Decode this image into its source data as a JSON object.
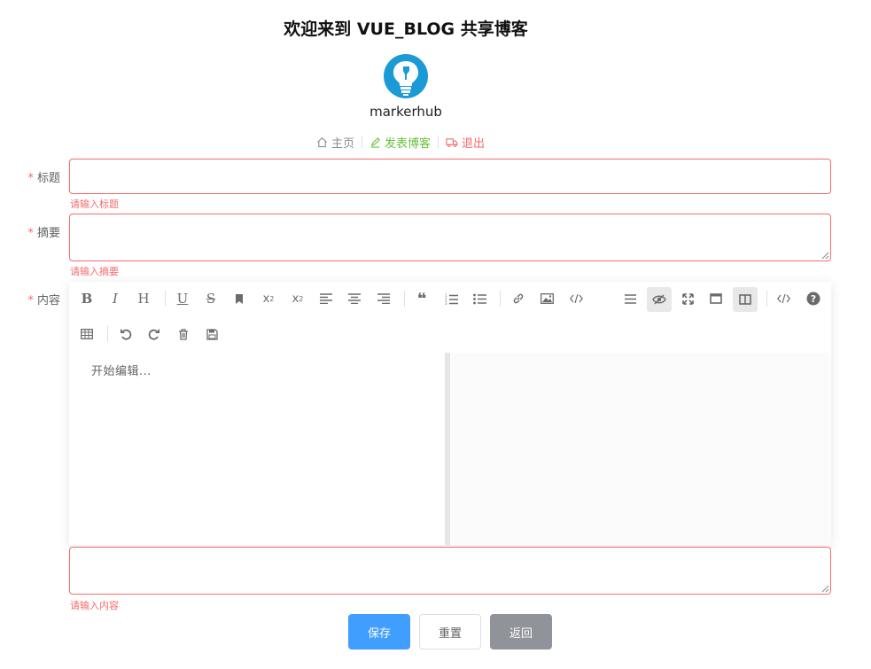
{
  "header": {
    "title": "欢迎来到 VUE_BLOG 共享博客",
    "username": "markerhub"
  },
  "nav": {
    "home": "主页",
    "post": "发表博客",
    "logout": "退出"
  },
  "form": {
    "required_mark": "*",
    "title_label": "标题",
    "title_value": "",
    "title_error": "请输入标题",
    "summary_label": "摘要",
    "summary_value": "",
    "summary_error": "请输入摘要",
    "content_label": "内容",
    "content_value": "",
    "content_error": "请输入内容"
  },
  "editor": {
    "placeholder": "开始编辑...",
    "toolbar": [
      "bold-icon",
      "italic-icon",
      "heading-icon",
      "underline-icon",
      "strikethrough-icon",
      "mark-icon",
      "superscript-icon",
      "subscript-icon",
      "align-left-icon",
      "align-center-icon",
      "align-right-icon",
      "quote-icon",
      "ordered-list-icon",
      "unordered-list-icon",
      "link-icon",
      "image-icon",
      "code-icon",
      "table-icon",
      "undo-icon",
      "redo-icon",
      "trash-icon",
      "save-icon",
      "menu-icon",
      "preview-icon",
      "fullscreen-icon",
      "window-icon",
      "subfield-icon",
      "html-icon",
      "help-icon"
    ]
  },
  "buttons": {
    "save": "保存",
    "reset": "重置",
    "back": "返回"
  },
  "colors": {
    "primary": "#409eff",
    "danger": "#f56c6c",
    "success": "#67c23a",
    "info": "#909399"
  }
}
